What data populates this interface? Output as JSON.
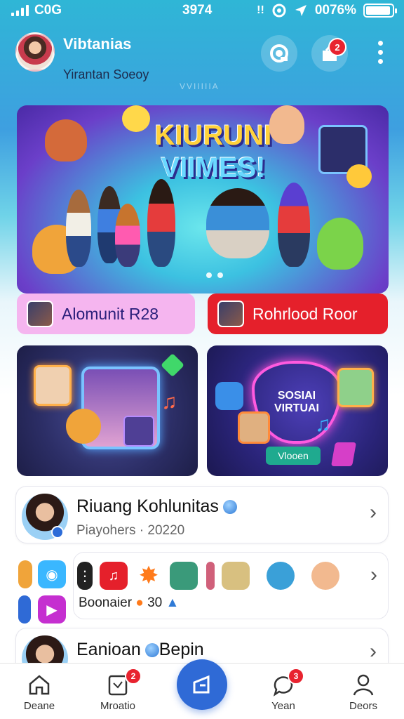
{
  "status_bar": {
    "carrier": "C0G",
    "time": "3974",
    "battery": "0076%"
  },
  "header": {
    "title": "Vibtanias",
    "subtitle": "Yirantan Soeoy",
    "notification_badge": "2",
    "watermark": "VVIIIIIA"
  },
  "hero": {
    "title_line1": "KIURUNI",
    "title_line2": "VIIMES!"
  },
  "pills": {
    "left_label": "Alomunit R28",
    "right_label": "Rohrlood Roor"
  },
  "cards": {
    "right_title": "SOSIAI VIRTUAI",
    "right_button": "Vlooen"
  },
  "rows": [
    {
      "title": "Riuang Kohlunitas",
      "subtitle": "Piayohers · 20220"
    },
    {
      "label": "Boonaier",
      "count": "30"
    },
    {
      "title": "Eanioan",
      "title2": "Bepin"
    }
  ],
  "bottom_nav": [
    {
      "label": "Deane",
      "icon": "home-icon"
    },
    {
      "label": "Mroatio",
      "icon": "media-icon",
      "badge": "2"
    },
    {
      "label": "",
      "icon": "create-icon"
    },
    {
      "label": "Yean",
      "icon": "chat-icon",
      "badge": "3"
    },
    {
      "label": "Deors",
      "icon": "profile-icon"
    }
  ],
  "colors": {
    "accent": "#2f6ad6",
    "badge": "#e8232f",
    "pill_pink": "#f5b5ef",
    "pill_red": "#e5202b"
  }
}
